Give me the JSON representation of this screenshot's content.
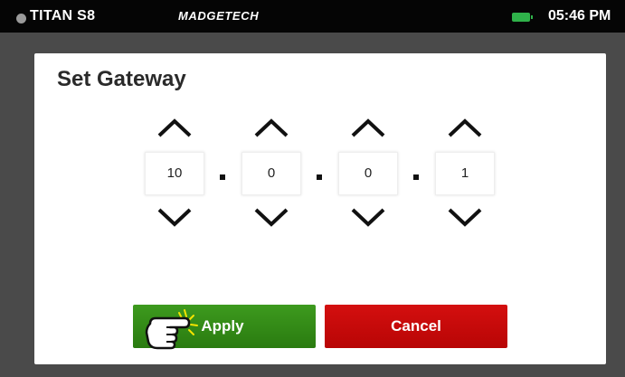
{
  "status_bar": {
    "device_name": "TITAN S8",
    "brand": "MADGETECH",
    "time": "05:46 PM",
    "battery_icon": "battery-full-icon",
    "battery_color": "#2fb24a"
  },
  "dialog": {
    "title": "Set Gateway",
    "octets": [
      "10",
      "0",
      "0",
      "1"
    ],
    "separator": "."
  },
  "buttons": {
    "apply_label": "Apply",
    "apply_color": "#338a17",
    "cancel_label": "Cancel",
    "cancel_color": "#c80a0a"
  },
  "icons": {
    "up": "chevron-up-icon",
    "down": "chevron-down-icon",
    "pointer": "hand-pointer-icon"
  }
}
